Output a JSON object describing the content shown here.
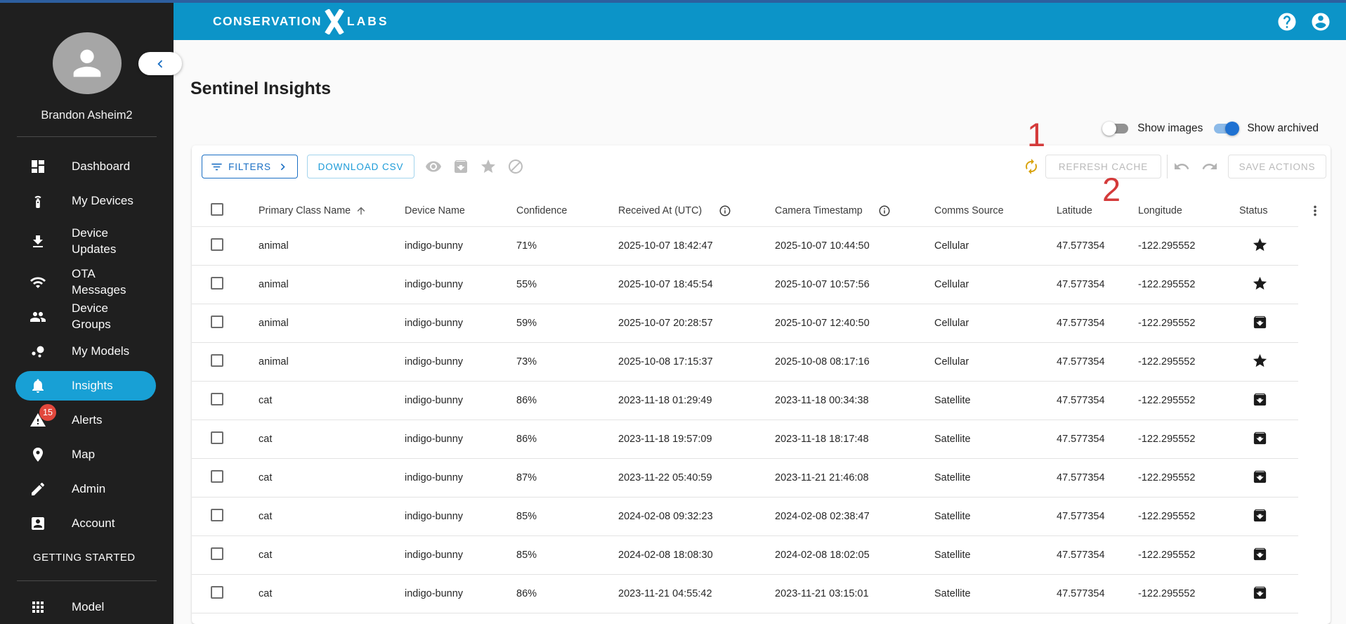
{
  "annotations": {
    "step1": "1",
    "step2": "2"
  },
  "colors": {
    "top_strip": "#2d5f9f",
    "header_blue": "#0c94c8",
    "sidebar_bg": "#1f1f1f",
    "active_item_blue": "#18a0d5",
    "badge_red": "#e2483d",
    "annotation_red": "#d43a3a",
    "filters_blue": "#1a6fc4",
    "download_blue": "#1c9bd8",
    "sync_yellow": "#d9a410",
    "toggle_on_blue": "#1f72d2"
  },
  "header": {
    "logo_left": "CONSERVATION",
    "logo_x": "X",
    "logo_right": "LABS",
    "icons": [
      "help",
      "account"
    ]
  },
  "sidebar": {
    "user_name": "Brandon Asheim2",
    "collapse_icon": "chevron-left",
    "items": [
      {
        "label": "Dashboard",
        "icon": "dashboard"
      },
      {
        "label": "My Devices",
        "icon": "device"
      },
      {
        "label": "Device Updates",
        "icon": "download"
      },
      {
        "label": "OTA Messages",
        "icon": "wifi"
      },
      {
        "label": "Device Groups",
        "icon": "people"
      },
      {
        "label": "My Models",
        "icon": "bubbles"
      },
      {
        "label": "Insights",
        "icon": "bell",
        "active": true
      },
      {
        "label": "Alerts",
        "icon": "warning",
        "badge": "15"
      },
      {
        "label": "Map",
        "icon": "pin"
      },
      {
        "label": "Admin",
        "icon": "pencil"
      },
      {
        "label": "Account",
        "icon": "account"
      }
    ],
    "section_label": "GETTING STARTED",
    "bottom_item": {
      "label": "Model",
      "icon": "apps"
    }
  },
  "page": {
    "title": "Sentinel Insights"
  },
  "toggles": {
    "show_images": {
      "label": "Show images",
      "on": false
    },
    "show_archived": {
      "label": "Show archived",
      "on": true
    }
  },
  "toolbar": {
    "filters_label": "FILTERS",
    "download_label": "DOWNLOAD CSV",
    "action_icons": [
      "visibility",
      "archive",
      "star",
      "block"
    ],
    "sync_icon": "autorenew",
    "refresh_label": "REFRESH CACHE",
    "undo_icon": "undo",
    "redo_icon": "redo",
    "save_label": "SAVE ACTIONS"
  },
  "table": {
    "columns": [
      {
        "label": "Primary Class Name",
        "sort": "asc"
      },
      {
        "label": "Device Name"
      },
      {
        "label": "Confidence"
      },
      {
        "label": "Received At (UTC)",
        "info": true
      },
      {
        "label": "Camera Timestamp",
        "info": true
      },
      {
        "label": "Comms Source"
      },
      {
        "label": "Latitude"
      },
      {
        "label": "Longitude"
      },
      {
        "label": "Status"
      }
    ],
    "rows": [
      {
        "primary_class": "animal",
        "device_name": "indigo-bunny",
        "confidence": "71%",
        "received_at": "2025-10-07 18:42:47",
        "camera_timestamp": "2025-10-07 10:44:50",
        "comms_source": "Cellular",
        "latitude": "47.577354",
        "longitude": "-122.295552",
        "status": "starred"
      },
      {
        "primary_class": "animal",
        "device_name": "indigo-bunny",
        "confidence": "55%",
        "received_at": "2025-10-07 18:45:54",
        "camera_timestamp": "2025-10-07 10:57:56",
        "comms_source": "Cellular",
        "latitude": "47.577354",
        "longitude": "-122.295552",
        "status": "starred"
      },
      {
        "primary_class": "animal",
        "device_name": "indigo-bunny",
        "confidence": "59%",
        "received_at": "2025-10-07 20:28:57",
        "camera_timestamp": "2025-10-07 12:40:50",
        "comms_source": "Cellular",
        "latitude": "47.577354",
        "longitude": "-122.295552",
        "status": "archived"
      },
      {
        "primary_class": "animal",
        "device_name": "indigo-bunny",
        "confidence": "73%",
        "received_at": "2025-10-08 17:15:37",
        "camera_timestamp": "2025-10-08 08:17:16",
        "comms_source": "Cellular",
        "latitude": "47.577354",
        "longitude": "-122.295552",
        "status": "starred"
      },
      {
        "primary_class": "cat",
        "device_name": "indigo-bunny",
        "confidence": "86%",
        "received_at": "2023-11-18 01:29:49",
        "camera_timestamp": "2023-11-18 00:34:38",
        "comms_source": "Satellite",
        "latitude": "47.577354",
        "longitude": "-122.295552",
        "status": "archived"
      },
      {
        "primary_class": "cat",
        "device_name": "indigo-bunny",
        "confidence": "86%",
        "received_at": "2023-11-18 19:57:09",
        "camera_timestamp": "2023-11-18 18:17:48",
        "comms_source": "Satellite",
        "latitude": "47.577354",
        "longitude": "-122.295552",
        "status": "archived"
      },
      {
        "primary_class": "cat",
        "device_name": "indigo-bunny",
        "confidence": "87%",
        "received_at": "2023-11-22 05:40:59",
        "camera_timestamp": "2023-11-21 21:46:08",
        "comms_source": "Satellite",
        "latitude": "47.577354",
        "longitude": "-122.295552",
        "status": "archived"
      },
      {
        "primary_class": "cat",
        "device_name": "indigo-bunny",
        "confidence": "85%",
        "received_at": "2024-02-08 09:32:23",
        "camera_timestamp": "2024-02-08 02:38:47",
        "comms_source": "Satellite",
        "latitude": "47.577354",
        "longitude": "-122.295552",
        "status": "archived"
      },
      {
        "primary_class": "cat",
        "device_name": "indigo-bunny",
        "confidence": "85%",
        "received_at": "2024-02-08 18:08:30",
        "camera_timestamp": "2024-02-08 18:02:05",
        "comms_source": "Satellite",
        "latitude": "47.577354",
        "longitude": "-122.295552",
        "status": "archived"
      },
      {
        "primary_class": "cat",
        "device_name": "indigo-bunny",
        "confidence": "86%",
        "received_at": "2023-11-21 04:55:42",
        "camera_timestamp": "2023-11-21 03:15:01",
        "comms_source": "Satellite",
        "latitude": "47.577354",
        "longitude": "-122.295552",
        "status": "archived"
      }
    ]
  }
}
